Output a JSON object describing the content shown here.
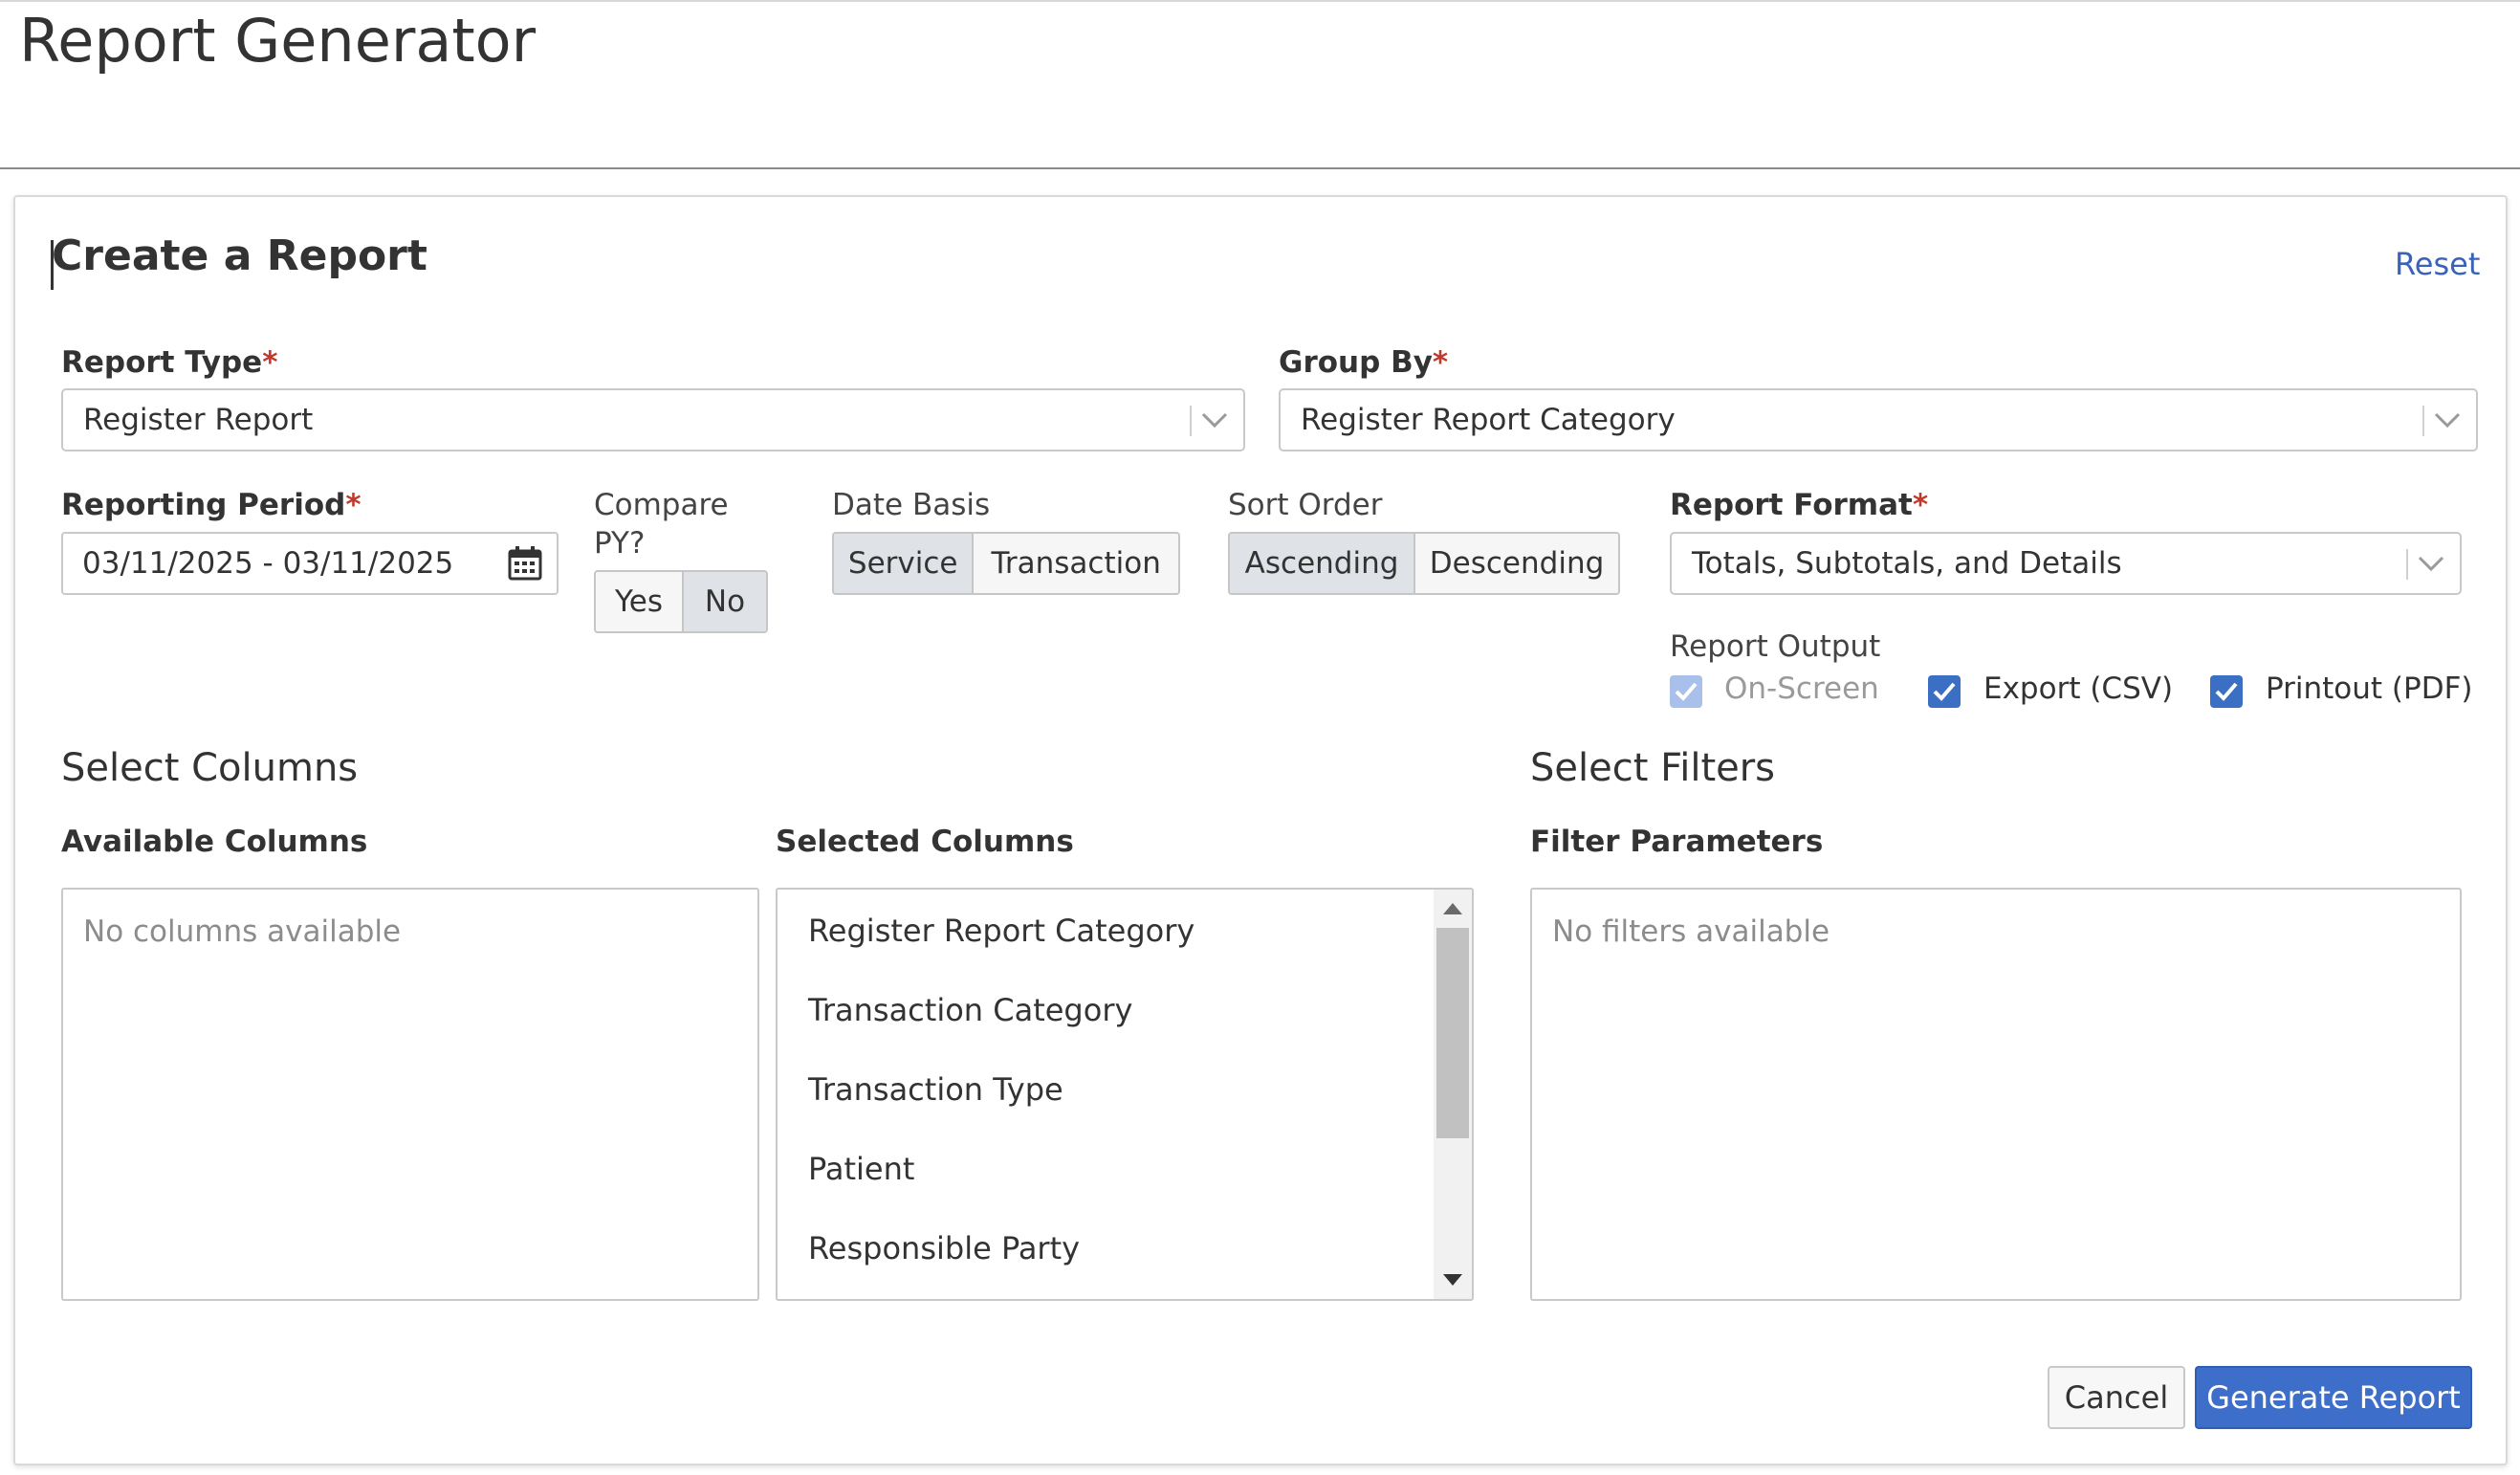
{
  "page": {
    "title": "Report Generator"
  },
  "card": {
    "title": "Create a Report",
    "reset_label": "Reset"
  },
  "fields": {
    "report_type": {
      "label": "Report Type",
      "required_mark": "*",
      "value": "Register Report"
    },
    "group_by": {
      "label": "Group By",
      "required_mark": "*",
      "value": "Register Report Category"
    },
    "reporting_period": {
      "label": "Reporting Period",
      "required_mark": "*",
      "value": "03/11/2025 - 03/11/2025"
    },
    "compare_py": {
      "label_line1": "Compare",
      "label_line2": "PY?",
      "options": [
        "Yes",
        "No"
      ],
      "selected": "No"
    },
    "date_basis": {
      "label": "Date Basis",
      "options": [
        "Service",
        "Transaction"
      ],
      "selected": "Service"
    },
    "sort_order": {
      "label": "Sort Order",
      "options": [
        "Ascending",
        "Descending"
      ],
      "selected": "Ascending"
    },
    "report_format": {
      "label": "Report Format",
      "required_mark": "*",
      "value": "Totals, Subtotals, and Details"
    },
    "report_output": {
      "label": "Report Output",
      "options": [
        {
          "label": "On-Screen",
          "checked": true,
          "disabled": true
        },
        {
          "label": "Export (CSV)",
          "checked": true,
          "disabled": false
        },
        {
          "label": "Printout (PDF)",
          "checked": true,
          "disabled": false
        }
      ]
    }
  },
  "columns": {
    "section_title": "Select Columns",
    "available_label": "Available Columns",
    "available_empty": "No columns available",
    "selected_label": "Selected Columns",
    "selected_items": [
      "Register Report Category",
      "Transaction Category",
      "Transaction Type",
      "Patient",
      "Responsible Party"
    ]
  },
  "filters": {
    "section_title": "Select Filters",
    "params_label": "Filter Parameters",
    "empty": "No filters available"
  },
  "actions": {
    "cancel_label": "Cancel",
    "generate_label": "Generate Report"
  },
  "colors": {
    "primary": "#3d6ec9",
    "required": "#c0392b",
    "link": "#3a62b8",
    "checkbox": "#3a6fc4",
    "checkbox_disabled": "#a9c1ea"
  },
  "icons": {
    "dropdown": "chevron-down-icon",
    "calendar": "calendar-icon",
    "check": "check-icon"
  }
}
